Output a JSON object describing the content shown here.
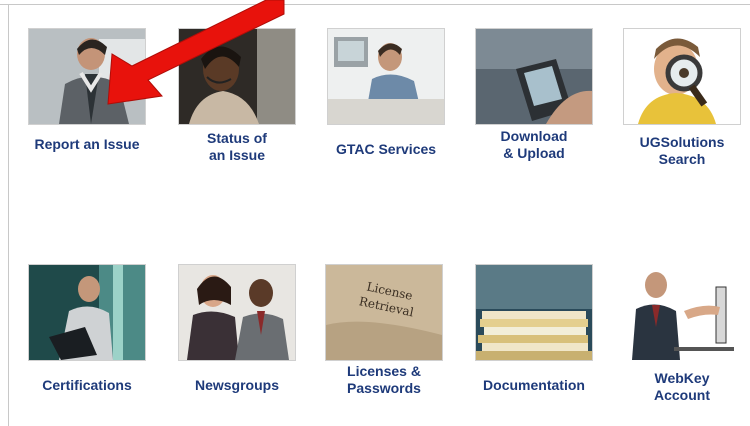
{
  "tiles": [
    {
      "label": "Report an Issue",
      "icon": "support-agent-photo-icon"
    },
    {
      "label": "Status of\nan Issue",
      "icon": "headset-agent-photo-icon"
    },
    {
      "label": "GTAC Services",
      "icon": "phone-call-photo-icon"
    },
    {
      "label": "Download\n& Upload",
      "icon": "pda-device-photo-icon"
    },
    {
      "label": "UGSolutions\nSearch",
      "icon": "magnifying-glass-photo-icon"
    },
    {
      "label": "Certifications",
      "icon": "laptop-user-photo-icon"
    },
    {
      "label": "Newsgroups",
      "icon": "business-people-photo-icon"
    },
    {
      "label": "Licenses &\nPasswords",
      "icon": "license-retrieval-photo-icon"
    },
    {
      "label": "Documentation",
      "icon": "paper-stack-photo-icon"
    },
    {
      "label": "WebKey\nAccount",
      "icon": "key-handover-photo-icon"
    }
  ],
  "license_photo_text": "License\nRetrieval",
  "arrow_color": "#e8120c",
  "label_color": "#1e3a7a"
}
